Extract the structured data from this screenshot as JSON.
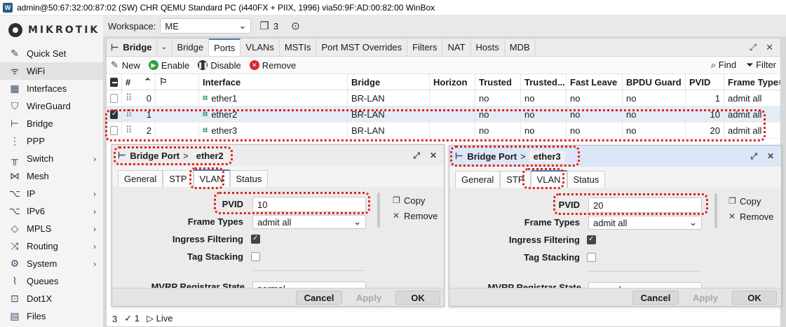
{
  "window_title": "admin@50:67:32:00:87:02 (SW) CHR QEMU Standard PC (i440FX + PIIX, 1996) via50:9F:AD:00:82:00 WinBox",
  "logo_text": "MIKROTIK",
  "sidebar": {
    "items": [
      {
        "label": "Quick Set",
        "icon": "wand-icon",
        "submenu": false
      },
      {
        "label": "WiFi",
        "icon": "wifi-icon",
        "submenu": false
      },
      {
        "label": "Interfaces",
        "icon": "interfaces-icon",
        "submenu": false
      },
      {
        "label": "WireGuard",
        "icon": "wireguard-icon",
        "submenu": false
      },
      {
        "label": "Bridge",
        "icon": "bridge-icon",
        "submenu": false
      },
      {
        "label": "PPP",
        "icon": "ppp-icon",
        "submenu": false
      },
      {
        "label": "Switch",
        "icon": "switch-icon",
        "submenu": true
      },
      {
        "label": "Mesh",
        "icon": "mesh-icon",
        "submenu": false
      },
      {
        "label": "IP",
        "icon": "ip-icon",
        "submenu": true
      },
      {
        "label": "IPv6",
        "icon": "ipv6-icon",
        "submenu": true
      },
      {
        "label": "MPLS",
        "icon": "mpls-icon",
        "submenu": true
      },
      {
        "label": "Routing",
        "icon": "routing-icon",
        "submenu": true
      },
      {
        "label": "System",
        "icon": "system-icon",
        "submenu": true
      },
      {
        "label": "Queues",
        "icon": "queues-icon",
        "submenu": false
      },
      {
        "label": "Dot1X",
        "icon": "dot1x-icon",
        "submenu": false
      },
      {
        "label": "Files",
        "icon": "files-icon",
        "submenu": false
      }
    ]
  },
  "workspace": {
    "label": "Workspace:",
    "value": "ME",
    "window_count": "3"
  },
  "bridge_window": {
    "title": "Bridge",
    "tabs": [
      "Bridge",
      "Ports",
      "VLANs",
      "MSTIs",
      "Port MST Overrides",
      "Filters",
      "NAT",
      "Hosts",
      "MDB"
    ],
    "active_tab": "Ports",
    "toolbar": {
      "new": "New",
      "enable": "Enable",
      "disable": "Disable",
      "remove": "Remove",
      "find": "Find",
      "filter": "Filter"
    },
    "columns": {
      "num": "#",
      "interface": "Interface",
      "bridge": "Bridge",
      "horizon": "Horizon",
      "trusted": "Trusted",
      "trusted2": "Trusted...",
      "fast_leave": "Fast Leave",
      "bpdu_guard": "BPDU Guard",
      "pvid": "PVID",
      "frame_type": "Frame Type"
    },
    "rows": [
      {
        "num": "0",
        "interface": "ether1",
        "bridge": "BR-LAN",
        "horizon": "",
        "trusted": "no",
        "trusted2": "no",
        "fast_leave": "no",
        "bpdu_guard": "no",
        "pvid": "1",
        "frame_type": "admit all"
      },
      {
        "num": "1",
        "interface": "ether2",
        "bridge": "BR-LAN",
        "horizon": "",
        "trusted": "no",
        "trusted2": "no",
        "fast_leave": "no",
        "bpdu_guard": "no",
        "pvid": "10",
        "frame_type": "admit all"
      },
      {
        "num": "2",
        "interface": "ether3",
        "bridge": "BR-LAN",
        "horizon": "",
        "trusted": "no",
        "trusted2": "no",
        "fast_leave": "no",
        "bpdu_guard": "no",
        "pvid": "20",
        "frame_type": "admit all"
      }
    ],
    "status": {
      "count": "3",
      "selected": "1",
      "live": "Live"
    }
  },
  "dialogs": [
    {
      "title": "Bridge Port",
      "sep": ">",
      "port": "ether2",
      "tabs": [
        "General",
        "STP",
        "VLAN",
        "Status"
      ],
      "active_tab": "VLAN",
      "fields": {
        "pvid_label": "PVID",
        "pvid": "10",
        "frame_types_label": "Frame Types",
        "frame_types": "admit all",
        "ingress_label": "Ingress Filtering",
        "tag_label": "Tag Stacking",
        "mvrp_label": "MVRP Registrar State",
        "mvrp": "normal"
      },
      "actions": {
        "copy": "Copy",
        "remove": "Remove"
      },
      "buttons": {
        "cancel": "Cancel",
        "apply": "Apply",
        "ok": "OK"
      }
    },
    {
      "title": "Bridge Port",
      "sep": ">",
      "port": "ether3",
      "tabs": [
        "General",
        "STP",
        "VLAN",
        "Status"
      ],
      "active_tab": "VLAN",
      "fields": {
        "pvid_label": "PVID",
        "pvid": "20",
        "frame_types_label": "Frame Types",
        "frame_types": "admit all",
        "ingress_label": "Ingress Filtering",
        "tag_label": "Tag Stacking",
        "mvrp_label": "MVRP Registrar State",
        "mvrp": "normal"
      },
      "actions": {
        "copy": "Copy",
        "remove": "Remove"
      },
      "buttons": {
        "cancel": "Cancel",
        "apply": "Apply",
        "ok": "OK"
      }
    }
  ],
  "colors": {
    "highlight": "#e0231b",
    "accent": "#4a7bc0",
    "enable": "#2ea043",
    "remove": "#d9262b"
  }
}
